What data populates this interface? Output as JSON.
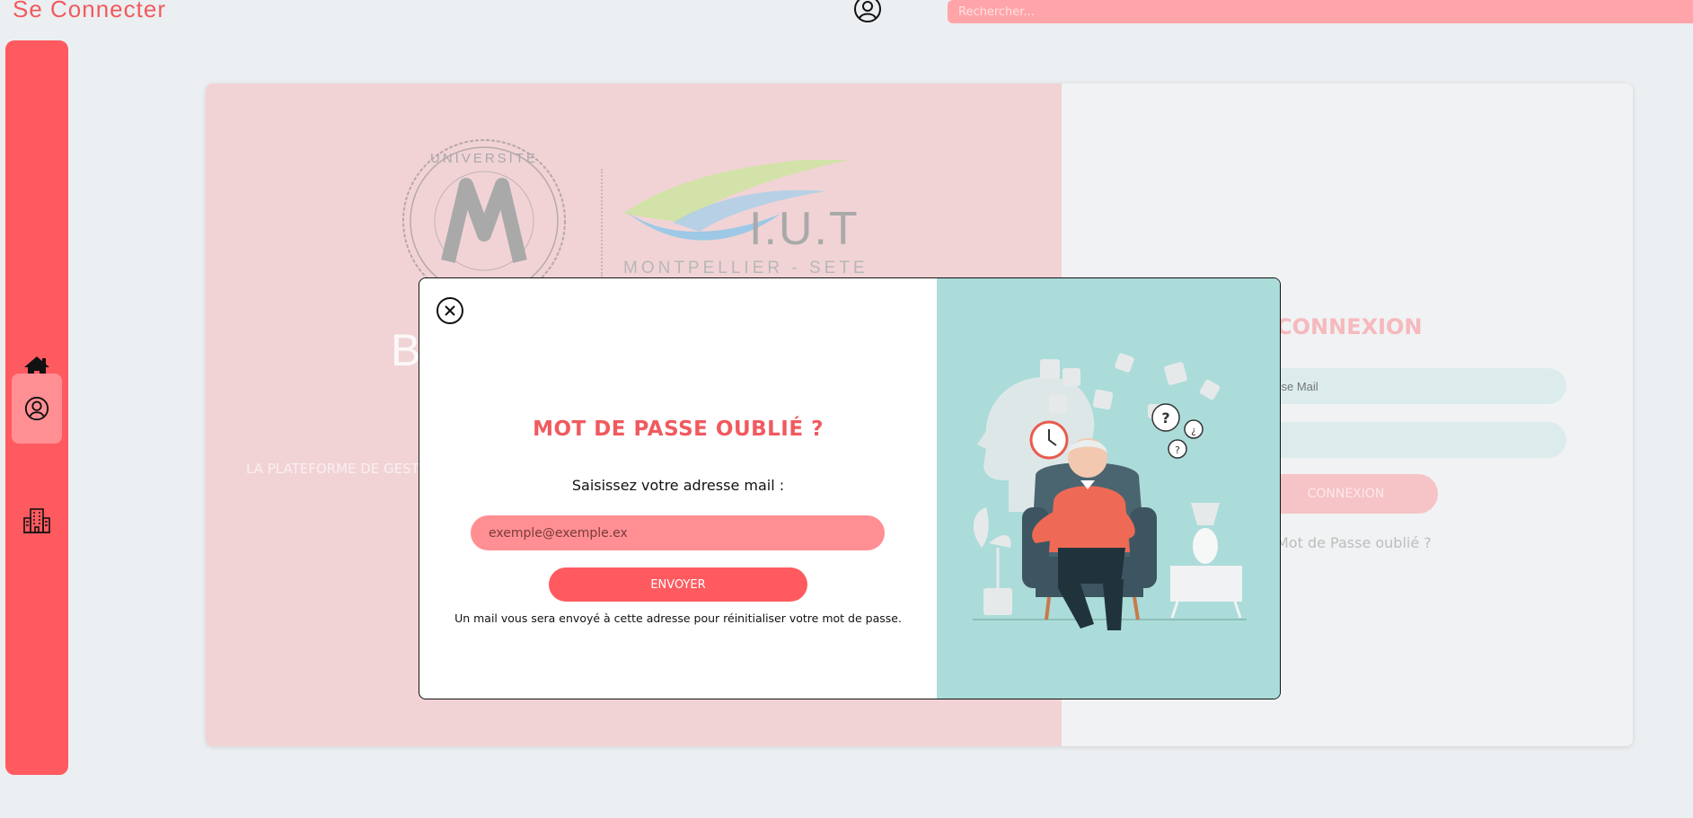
{
  "header": {
    "brand": "Se Connecter",
    "user_icon": "user-circle-icon",
    "search_placeholder": "Rechercher..."
  },
  "sidebar": {
    "items": [
      {
        "icon": "home-icon",
        "active": false
      },
      {
        "icon": "user-circle-icon",
        "active": true
      },
      {
        "icon": "building-icon",
        "active": false
      }
    ]
  },
  "background": {
    "logo_um_text": "UNIVERSITE MONTPELLIER",
    "logo_iut_text": "I.U.T",
    "logo_iut_subtitle": "MONTPELLIER - SETE",
    "big_letter": "B",
    "tagline": "LA PLATEFORME DE GEST",
    "login": {
      "title": "CONNEXION",
      "email_placeholder": "sse Mail",
      "password_placeholder": "",
      "submit_label": "CONNEXION",
      "forgot_link": "Mot de Passe oublié ?"
    }
  },
  "modal": {
    "title": "MOT DE PASSE OUBLIÉ ?",
    "label": "Saisissez votre adresse mail :",
    "email_placeholder": "exemple@exemple.ex",
    "send_label": "ENVOYER",
    "note": "Un mail vous sera envoyé à cette adresse pour réinitialiser votre mot de passe.",
    "illustration": "confused-elderly-man-illustration"
  },
  "colors": {
    "accent": "#ff5a5f",
    "accent_light": "#ff8f93",
    "illustration_bg": "#abdcd9"
  }
}
